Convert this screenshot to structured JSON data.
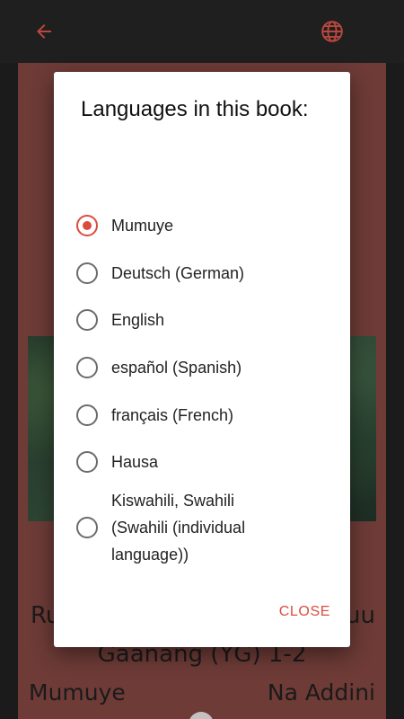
{
  "appbar": {
    "back_icon": "arrow-back-icon",
    "language_icon": "globe-icon",
    "accent_color": "#b8473d"
  },
  "book": {
    "title_line1_left": "Ru",
    "title_line1_right": "uu",
    "title_line2": "Gaanang (YG) 1-2",
    "language": "Mumuye",
    "author": "Na Addini",
    "page_color": "#6e3b37"
  },
  "dialog": {
    "title": "Languages in this book:",
    "options": [
      {
        "label": "Mumuye",
        "selected": true
      },
      {
        "label": "Deutsch (German)",
        "selected": false
      },
      {
        "label": "English",
        "selected": false
      },
      {
        "label": "español (Spanish)",
        "selected": false
      },
      {
        "label": "français (French)",
        "selected": false
      },
      {
        "label": "Hausa",
        "selected": false
      },
      {
        "label": "Kiswahili, Swahili (Swahili (individual language))",
        "selected": false
      }
    ],
    "close_label": "CLOSE",
    "accent_color": "#d94d3f"
  }
}
